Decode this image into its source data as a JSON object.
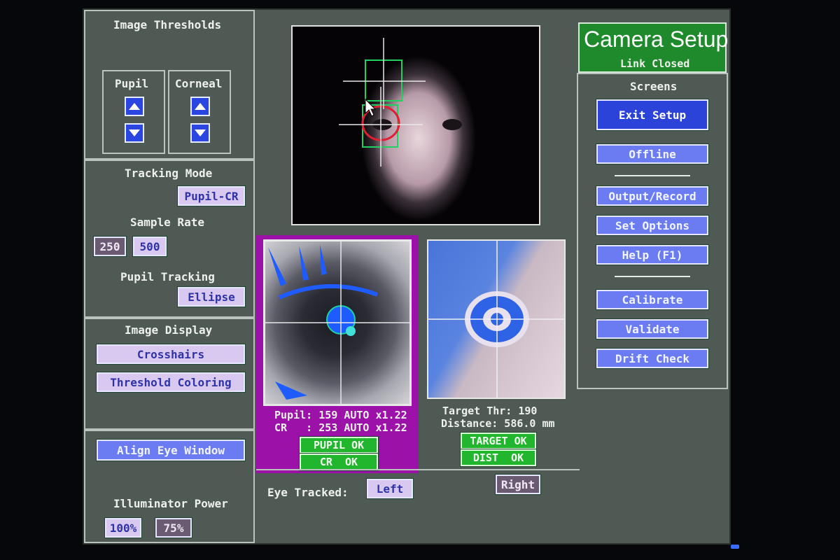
{
  "left": {
    "image_thresholds_title": "Image Thresholds",
    "pupil_label": "Pupil",
    "corneal_label": "Corneal",
    "tracking_mode_title": "Tracking Mode",
    "tracking_mode_value": "Pupil-CR",
    "sample_rate_title": "Sample Rate",
    "rate_250": "250",
    "rate_500": "500",
    "pupil_tracking_title": "Pupil Tracking",
    "pupil_tracking_value": "Ellipse",
    "image_display_title": "Image Display",
    "crosshairs_label": "Crosshairs",
    "threshold_coloring_label": "Threshold Coloring",
    "align_eye_window_label": "Align Eye Window",
    "illuminator_title": "Illuminator Power",
    "power_100": "100%",
    "power_75": "75%"
  },
  "center": {
    "pupil_line": "Pupil: 159 AUTO x1.22",
    "cr_line": "CR   : 253 AUTO x1.22",
    "pupil_ok": "PUPIL OK",
    "cr_ok": "CR  OK",
    "target_thr": "Target Thr: 190",
    "distance": "Distance: 586.0 mm",
    "target_ok": "TARGET OK",
    "dist_ok": "DIST  OK",
    "eye_tracked_label": "Eye Tracked:",
    "left_label": "Left",
    "right_label": "Right"
  },
  "right": {
    "title": "Camera Setup",
    "link_status": "Link Closed",
    "screens_title": "Screens",
    "exit_setup": "Exit Setup",
    "offline": "Offline",
    "output_record": "Output/Record",
    "set_options": "Set Options",
    "help": "Help (F1)",
    "calibrate": "Calibrate",
    "validate": "Validate",
    "drift_check": "Drift Check"
  },
  "colors": {
    "screen_bg": "#4f5a55",
    "title_green": "#1f8a2c",
    "status_magenta": "#9c12a8",
    "threshold_blue": "#1f5cff",
    "ok_green": "#22b52e"
  }
}
